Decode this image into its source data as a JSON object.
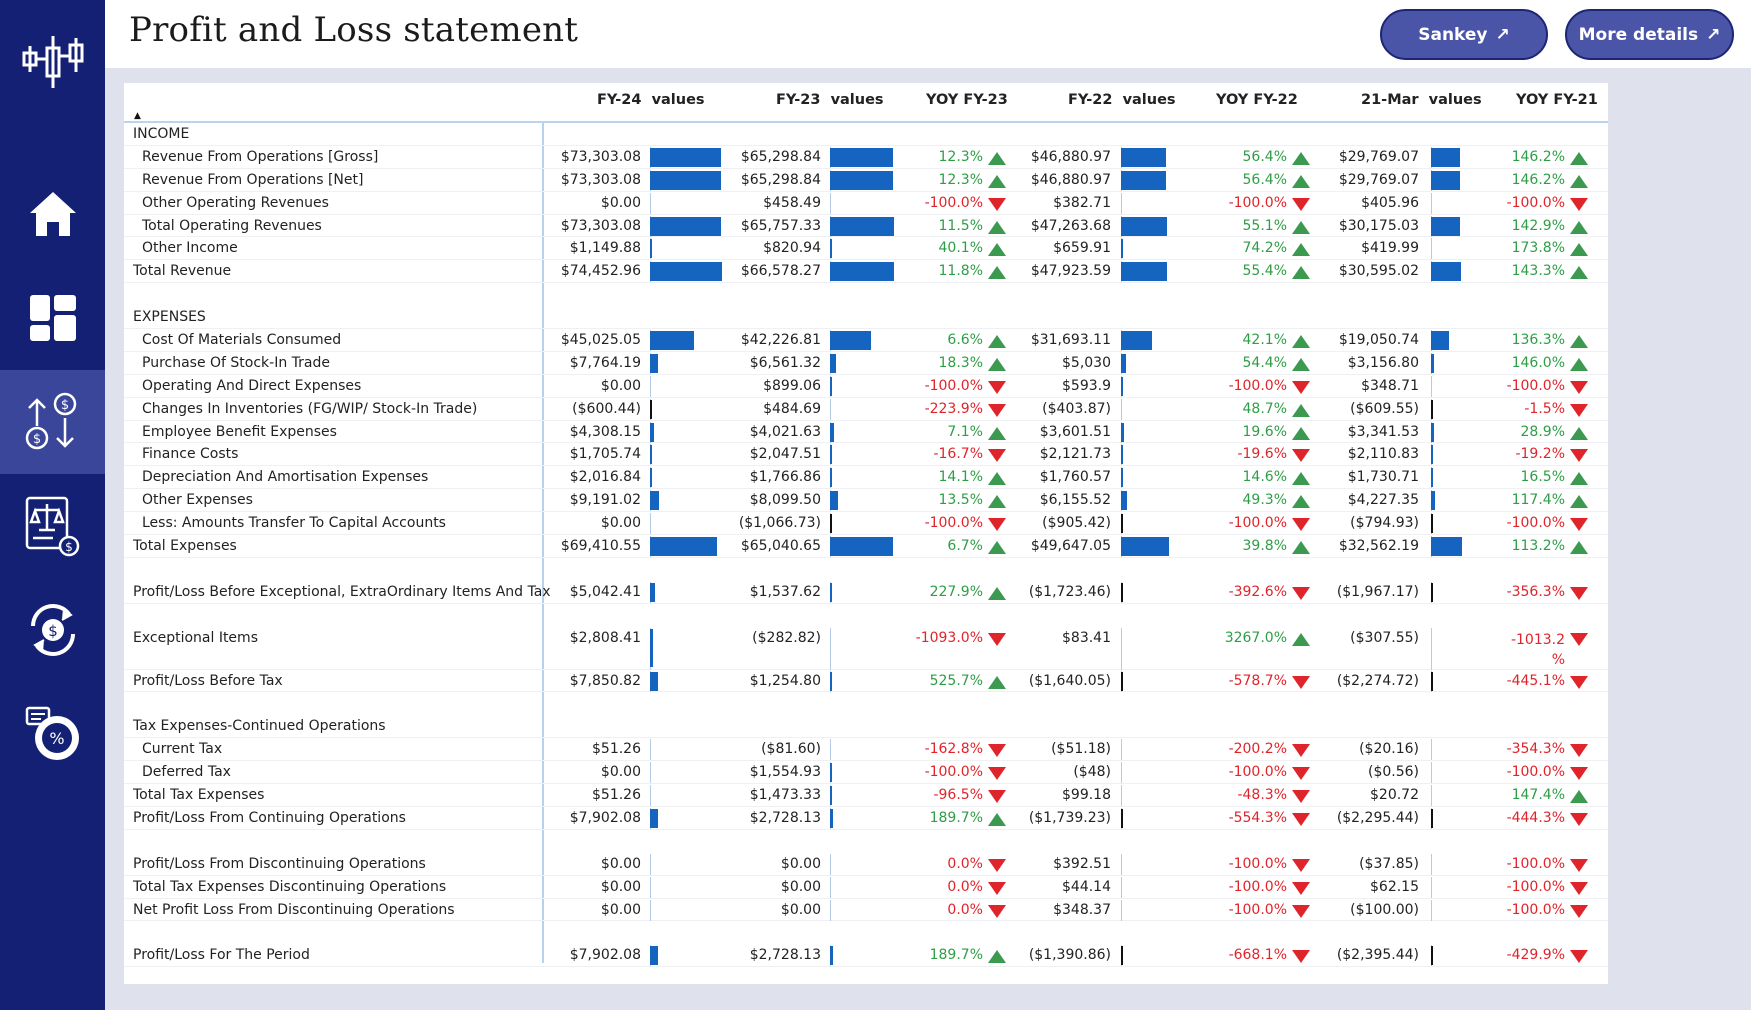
{
  "page": {
    "title": "Profit and Loss statement"
  },
  "header": {
    "sankey_label": "Sankey",
    "details_label": "More details",
    "arrow_glyph": "↗"
  },
  "sidebar": {
    "logo": "candlestick-logo-icon",
    "items": [
      {
        "name": "home",
        "icon": "home-icon",
        "active": false
      },
      {
        "name": "dashboard",
        "icon": "dashboard-grid-icon",
        "active": false
      },
      {
        "name": "cashflow",
        "icon": "dollar-transfer-icon",
        "active": true
      },
      {
        "name": "balance",
        "icon": "balance-scale-icon",
        "active": false
      },
      {
        "name": "exchange",
        "icon": "currency-exchange-icon",
        "active": false
      },
      {
        "name": "ratios",
        "icon": "percent-chart-icon",
        "active": false
      }
    ]
  },
  "colors": {
    "bar": "#1565c0",
    "up": "#2e9e46",
    "down": "#e0242b",
    "sidebar": "#142073",
    "sidebar_active": "#3a469a",
    "button": "#4a55a8"
  },
  "table": {
    "columns": [
      "FY-24  values",
      "FY-23  values",
      "YOY FY-23",
      "FY-22  values",
      "YOY FY-22",
      "21-Mar  values",
      "YOY FY-21"
    ],
    "sort_indicator": "▲",
    "bar_scale_max": 74452.96,
    "rows": [
      {
        "type": "header",
        "label": "INCOME"
      },
      {
        "type": "data",
        "indent": true,
        "label": "Revenue From Operations [Gross]",
        "fy24": "$73,303.08",
        "v24": 73303.08,
        "fy23": "$65,298.84",
        "v23": 65298.84,
        "yoy23": "12.3%",
        "d23": "up",
        "fy22": "$46,880.97",
        "v22": 46880.97,
        "yoy22": "56.4%",
        "d22": "up",
        "fy21": "$29,769.07",
        "v21": 29769.07,
        "yoy21": "146.2%",
        "d21": "up"
      },
      {
        "type": "data",
        "indent": true,
        "label": "Revenue From Operations [Net]",
        "fy24": "$73,303.08",
        "v24": 73303.08,
        "fy23": "$65,298.84",
        "v23": 65298.84,
        "yoy23": "12.3%",
        "d23": "up",
        "fy22": "$46,880.97",
        "v22": 46880.97,
        "yoy22": "56.4%",
        "d22": "up",
        "fy21": "$29,769.07",
        "v21": 29769.07,
        "yoy21": "146.2%",
        "d21": "up"
      },
      {
        "type": "data",
        "indent": true,
        "label": "Other Operating Revenues",
        "fy24": "$0.00",
        "v24": 0,
        "fy23": "$458.49",
        "v23": 458.49,
        "yoy23": "-100.0%",
        "d23": "down",
        "fy22": "$382.71",
        "v22": 382.71,
        "yoy22": "-100.0%",
        "d22": "down",
        "fy21": "$405.96",
        "v21": 405.96,
        "yoy21": "-100.0%",
        "d21": "down"
      },
      {
        "type": "data",
        "indent": true,
        "label": "Total Operating Revenues",
        "fy24": "$73,303.08",
        "v24": 73303.08,
        "fy23": "$65,757.33",
        "v23": 65757.33,
        "yoy23": "11.5%",
        "d23": "up",
        "fy22": "$47,263.68",
        "v22": 47263.68,
        "yoy22": "55.1%",
        "d22": "up",
        "fy21": "$30,175.03",
        "v21": 30175.03,
        "yoy21": "142.9%",
        "d21": "up"
      },
      {
        "type": "data",
        "indent": true,
        "label": "Other Income",
        "fy24": "$1,149.88",
        "v24": 1149.88,
        "fy23": "$820.94",
        "v23": 820.94,
        "yoy23": "40.1%",
        "d23": "up",
        "fy22": "$659.91",
        "v22": 659.91,
        "yoy22": "74.2%",
        "d22": "up",
        "fy21": "$419.99",
        "v21": 419.99,
        "yoy21": "173.8%",
        "d21": "up"
      },
      {
        "type": "data",
        "indent": false,
        "label": "Total Revenue",
        "fy24": "$74,452.96",
        "v24": 74452.96,
        "fy23": "$66,578.27",
        "v23": 66578.27,
        "yoy23": "11.8%",
        "d23": "up",
        "fy22": "$47,923.59",
        "v22": 47923.59,
        "yoy22": "55.4%",
        "d22": "up",
        "fy21": "$30,595.02",
        "v21": 30595.02,
        "yoy21": "143.3%",
        "d21": "up"
      },
      {
        "type": "blank"
      },
      {
        "type": "header",
        "label": "EXPENSES"
      },
      {
        "type": "data",
        "indent": true,
        "label": "Cost Of Materials Consumed",
        "fy24": "$45,025.05",
        "v24": 45025.05,
        "fy23": "$42,226.81",
        "v23": 42226.81,
        "yoy23": "6.6%",
        "d23": "up",
        "fy22": "$31,693.11",
        "v22": 31693.11,
        "yoy22": "42.1%",
        "d22": "up",
        "fy21": "$19,050.74",
        "v21": 19050.74,
        "yoy21": "136.3%",
        "d21": "up"
      },
      {
        "type": "data",
        "indent": true,
        "label": "Purchase Of Stock-In Trade",
        "fy24": "$7,764.19",
        "v24": 7764.19,
        "fy23": "$6,561.32",
        "v23": 6561.32,
        "yoy23": "18.3%",
        "d23": "up",
        "fy22": "$5,030",
        "v22": 5030,
        "yoy22": "54.4%",
        "d22": "up",
        "fy21": "$3,156.80",
        "v21": 3156.8,
        "yoy21": "146.0%",
        "d21": "up"
      },
      {
        "type": "data",
        "indent": true,
        "label": "Operating And Direct Expenses",
        "fy24": "$0.00",
        "v24": 0,
        "fy23": "$899.06",
        "v23": 899.06,
        "yoy23": "-100.0%",
        "d23": "down",
        "fy22": "$593.9",
        "v22": 593.9,
        "yoy22": "-100.0%",
        "d22": "down",
        "fy21": "$348.71",
        "v21": 348.71,
        "yoy21": "-100.0%",
        "d21": "down"
      },
      {
        "type": "data",
        "indent": true,
        "label": "Changes In Inventories (FG/WIP/ Stock-In Trade)",
        "fy24": "($600.44)",
        "v24": -600.44,
        "fy23": "$484.69",
        "v23": 484.69,
        "yoy23": "-223.9%",
        "d23": "down",
        "fy22": "($403.87)",
        "v22": -403.87,
        "yoy22": "48.7%",
        "d22": "up",
        "fy21": "($609.55)",
        "v21": -609.55,
        "yoy21": "-1.5%",
        "d21": "down"
      },
      {
        "type": "data",
        "indent": true,
        "label": "Employee Benefit Expenses",
        "fy24": "$4,308.15",
        "v24": 4308.15,
        "fy23": "$4,021.63",
        "v23": 4021.63,
        "yoy23": "7.1%",
        "d23": "up",
        "fy22": "$3,601.51",
        "v22": 3601.51,
        "yoy22": "19.6%",
        "d22": "up",
        "fy21": "$3,341.53",
        "v21": 3341.53,
        "yoy21": "28.9%",
        "d21": "up"
      },
      {
        "type": "data",
        "indent": true,
        "label": "Finance Costs",
        "fy24": "$1,705.74",
        "v24": 1705.74,
        "fy23": "$2,047.51",
        "v23": 2047.51,
        "yoy23": "-16.7%",
        "d23": "down",
        "fy22": "$2,121.73",
        "v22": 2121.73,
        "yoy22": "-19.6%",
        "d22": "down",
        "fy21": "$2,110.83",
        "v21": 2110.83,
        "yoy21": "-19.2%",
        "d21": "down"
      },
      {
        "type": "data",
        "indent": true,
        "label": "Depreciation And Amortisation Expenses",
        "fy24": "$2,016.84",
        "v24": 2016.84,
        "fy23": "$1,766.86",
        "v23": 1766.86,
        "yoy23": "14.1%",
        "d23": "up",
        "fy22": "$1,760.57",
        "v22": 1760.57,
        "yoy22": "14.6%",
        "d22": "up",
        "fy21": "$1,730.71",
        "v21": 1730.71,
        "yoy21": "16.5%",
        "d21": "up"
      },
      {
        "type": "data",
        "indent": true,
        "label": "Other Expenses",
        "fy24": "$9,191.02",
        "v24": 9191.02,
        "fy23": "$8,099.50",
        "v23": 8099.5,
        "yoy23": "13.5%",
        "d23": "up",
        "fy22": "$6,155.52",
        "v22": 6155.52,
        "yoy22": "49.3%",
        "d22": "up",
        "fy21": "$4,227.35",
        "v21": 4227.35,
        "yoy21": "117.4%",
        "d21": "up"
      },
      {
        "type": "data",
        "indent": true,
        "label": "Less: Amounts Transfer To Capital Accounts",
        "fy24": "$0.00",
        "v24": 0,
        "fy23": "($1,066.73)",
        "v23": -1066.73,
        "yoy23": "-100.0%",
        "d23": "down",
        "fy22": "($905.42)",
        "v22": -905.42,
        "yoy22": "-100.0%",
        "d22": "down",
        "fy21": "($794.93)",
        "v21": -794.93,
        "yoy21": "-100.0%",
        "d21": "down"
      },
      {
        "type": "data",
        "indent": false,
        "label": "Total Expenses",
        "fy24": "$69,410.55",
        "v24": 69410.55,
        "fy23": "$65,040.65",
        "v23": 65040.65,
        "yoy23": "6.7%",
        "d23": "up",
        "fy22": "$49,647.05",
        "v22": 49647.05,
        "yoy22": "39.8%",
        "d22": "up",
        "fy21": "$32,562.19",
        "v21": 32562.19,
        "yoy21": "113.2%",
        "d21": "up"
      },
      {
        "type": "blank"
      },
      {
        "type": "data",
        "indent": false,
        "label": "Profit/Loss Before Exceptional, ExtraOrdinary Items And Tax",
        "fy24": "$5,042.41",
        "v24": 5042.41,
        "fy23": "$1,537.62",
        "v23": 1537.62,
        "yoy23": "227.9%",
        "d23": "up",
        "fy22": "($1,723.46)",
        "v22": -1723.46,
        "yoy22": "-392.6%",
        "d22": "down",
        "fy21": "($1,967.17)",
        "v21": -1967.17,
        "yoy21": "-356.3%",
        "d21": "down"
      },
      {
        "type": "blank"
      },
      {
        "type": "data",
        "indent": false,
        "tall": true,
        "label": "Exceptional Items",
        "fy24": "$2,808.41",
        "v24": 2808.41,
        "fy23": "($282.82)",
        "v23": -282.82,
        "yoy23": "-1093.0%",
        "d23": "down",
        "fy22": "$83.41",
        "v22": 83.41,
        "yoy22": "3267.0%",
        "d22": "up",
        "fy21": "($307.55)",
        "v21": -307.55,
        "yoy21": "-1013.2\n%",
        "d21": "down"
      },
      {
        "type": "data",
        "indent": false,
        "label": "Profit/Loss Before Tax",
        "fy24": "$7,850.82",
        "v24": 7850.82,
        "fy23": "$1,254.80",
        "v23": 1254.8,
        "yoy23": "525.7%",
        "d23": "up",
        "fy22": "($1,640.05)",
        "v22": -1640.05,
        "yoy22": "-578.7%",
        "d22": "down",
        "fy21": "($2,274.72)",
        "v21": -2274.72,
        "yoy21": "-445.1%",
        "d21": "down"
      },
      {
        "type": "blank"
      },
      {
        "type": "header",
        "label": "Tax Expenses-Continued Operations"
      },
      {
        "type": "data",
        "indent": true,
        "label": "Current Tax",
        "fy24": "$51.26",
        "v24": 51.26,
        "fy23": "($81.60)",
        "v23": -81.6,
        "yoy23": "-162.8%",
        "d23": "down",
        "fy22": "($51.18)",
        "v22": -51.18,
        "yoy22": "-200.2%",
        "d22": "down",
        "fy21": "($20.16)",
        "v21": -20.16,
        "yoy21": "-354.3%",
        "d21": "down"
      },
      {
        "type": "data",
        "indent": true,
        "label": "Deferred Tax",
        "fy24": "$0.00",
        "v24": 0,
        "fy23": "$1,554.93",
        "v23": 1554.93,
        "yoy23": "-100.0%",
        "d23": "down",
        "fy22": "($48)",
        "v22": -48,
        "yoy22": "-100.0%",
        "d22": "down",
        "fy21": "($0.56)",
        "v21": -0.56,
        "yoy21": "-100.0%",
        "d21": "down"
      },
      {
        "type": "data",
        "indent": false,
        "label": "Total Tax Expenses",
        "fy24": "$51.26",
        "v24": 51.26,
        "fy23": "$1,473.33",
        "v23": 1473.33,
        "yoy23": "-96.5%",
        "d23": "down",
        "fy22": "$99.18",
        "v22": 99.18,
        "yoy22": "-48.3%",
        "d22": "down",
        "fy21": "$20.72",
        "v21": 20.72,
        "yoy21": "147.4%",
        "d21": "up"
      },
      {
        "type": "data",
        "indent": false,
        "label": "Profit/Loss From Continuing Operations",
        "fy24": "$7,902.08",
        "v24": 7902.08,
        "fy23": "$2,728.13",
        "v23": 2728.13,
        "yoy23": "189.7%",
        "d23": "up",
        "fy22": "($1,739.23)",
        "v22": -1739.23,
        "yoy22": "-554.3%",
        "d22": "down",
        "fy21": "($2,295.44)",
        "v21": -2295.44,
        "yoy21": "-444.3%",
        "d21": "down"
      },
      {
        "type": "blank"
      },
      {
        "type": "data",
        "indent": false,
        "label": "Profit/Loss From Discontinuing Operations",
        "fy24": "$0.00",
        "v24": 0,
        "fy23": "$0.00",
        "v23": 0,
        "yoy23": "0.0%",
        "d23": "down",
        "fy22": "$392.51",
        "v22": 392.51,
        "yoy22": "-100.0%",
        "d22": "down",
        "fy21": "($37.85)",
        "v21": -37.85,
        "yoy21": "-100.0%",
        "d21": "down"
      },
      {
        "type": "data",
        "indent": false,
        "label": "Total Tax Expenses Discontinuing Operations",
        "fy24": "$0.00",
        "v24": 0,
        "fy23": "$0.00",
        "v23": 0,
        "yoy23": "0.0%",
        "d23": "down",
        "fy22": "$44.14",
        "v22": 44.14,
        "yoy22": "-100.0%",
        "d22": "down",
        "fy21": "$62.15",
        "v21": 62.15,
        "yoy21": "-100.0%",
        "d21": "down"
      },
      {
        "type": "data",
        "indent": false,
        "label": "Net Profit Loss From Discontinuing Operations",
        "fy24": "$0.00",
        "v24": 0,
        "fy23": "$0.00",
        "v23": 0,
        "yoy23": "0.0%",
        "d23": "down",
        "fy22": "$348.37",
        "v22": 348.37,
        "yoy22": "-100.0%",
        "d22": "down",
        "fy21": "($100.00)",
        "v21": -100.0,
        "yoy21": "-100.0%",
        "d21": "down"
      },
      {
        "type": "blank"
      },
      {
        "type": "data",
        "indent": false,
        "label": "Profit/Loss For The Period",
        "fy24": "$7,902.08",
        "v24": 7902.08,
        "fy23": "$2,728.13",
        "v23": 2728.13,
        "yoy23": "189.7%",
        "d23": "up",
        "fy22": "($1,390.86)",
        "v22": -1390.86,
        "yoy22": "-668.1%",
        "d22": "down",
        "fy21": "($2,395.44)",
        "v21": -2395.44,
        "yoy21": "-429.9%",
        "d21": "down"
      }
    ]
  }
}
